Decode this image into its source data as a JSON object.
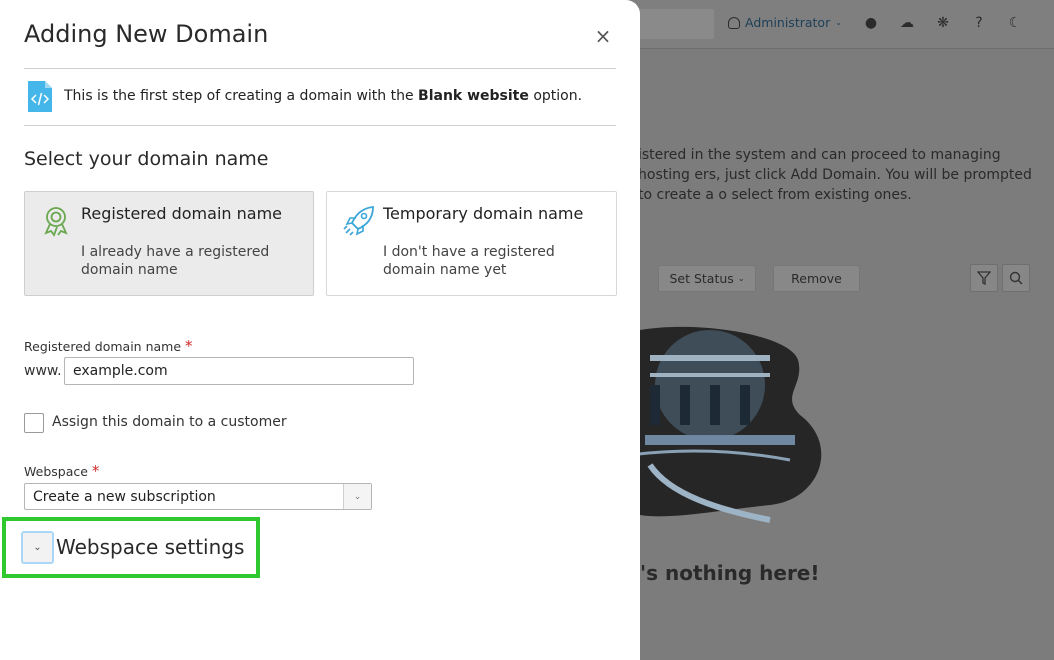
{
  "background": {
    "user_label": "Administrator",
    "description": "istered in the system and can proceed to managing hosting ers, just click Add Domain. You will be prompted to create a o select from existing ones.",
    "set_status_label": "Set Status",
    "remove_label": "Remove",
    "empty_message": "'s nothing here!"
  },
  "modal": {
    "title": "Adding New Domain",
    "close_glyph": "×",
    "info_prefix": "This is the first step of creating a domain with the ",
    "info_bold": "Blank website",
    "info_suffix": " option.",
    "section_title": "Select your domain name",
    "cards": [
      {
        "title": "Registered domain name",
        "desc": "I already have a registered domain name",
        "selected": true,
        "icon": "award-icon"
      },
      {
        "title": "Temporary domain name",
        "desc": "I don't have a registered domain name yet",
        "selected": false,
        "icon": "rocket-icon"
      }
    ],
    "domain_field": {
      "label": "Registered domain name",
      "required_mark": "*",
      "prefix": "www.",
      "value": "example.com"
    },
    "assign_customer": {
      "label": "Assign this domain to a customer",
      "checked": false
    },
    "webspace": {
      "label": "Webspace",
      "required_mark": "*",
      "selected": "Create a new subscription"
    },
    "webspace_settings": {
      "label": "Webspace settings",
      "collapsed": true
    }
  },
  "colors": {
    "highlight": "#2fc92f",
    "accent_icon": "#3ba7d9",
    "award_icon": "#6aa84f",
    "required": "#d02b2b"
  }
}
